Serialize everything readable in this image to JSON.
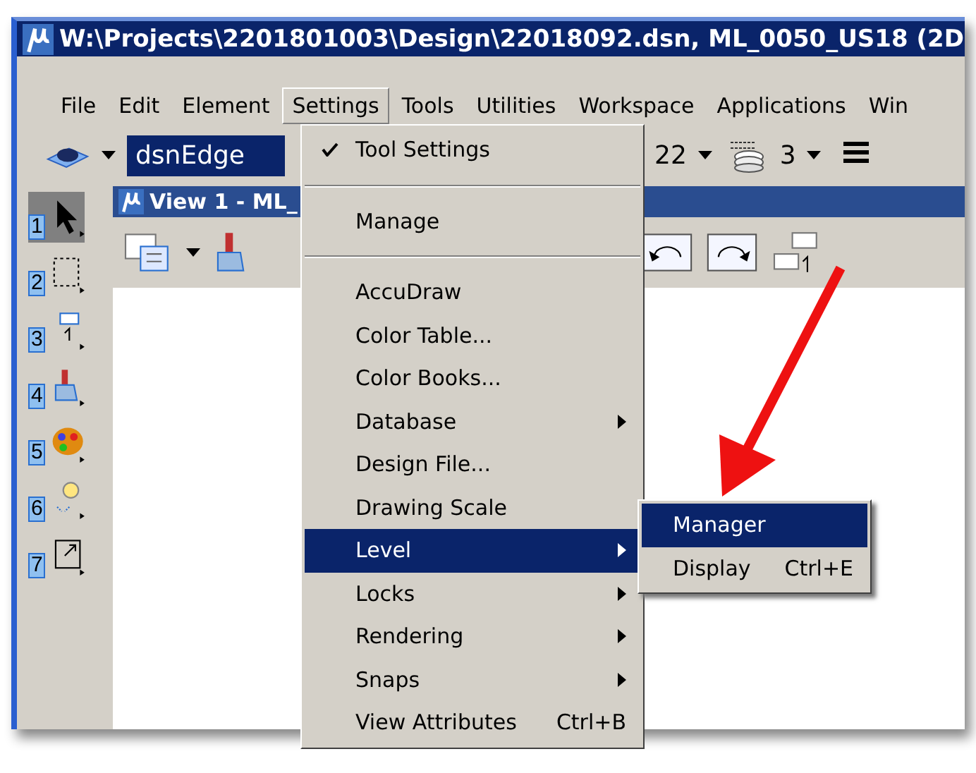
{
  "window": {
    "title": "W:\\Projects\\2201801003\\Design\\22018092.dsn, ML_0050_US18 (2D"
  },
  "menu_bar": [
    {
      "label": "File",
      "selected": false
    },
    {
      "label": "Edit",
      "selected": false
    },
    {
      "label": "Element",
      "selected": false
    },
    {
      "label": "Settings",
      "selected": true
    },
    {
      "label": "Tools",
      "selected": false
    },
    {
      "label": "Utilities",
      "selected": false
    },
    {
      "label": "Workspace",
      "selected": false
    },
    {
      "label": "Applications",
      "selected": false
    },
    {
      "label": "Win",
      "selected": false
    }
  ],
  "toolbar": {
    "combo_value": "dsnEdge",
    "field_2": "22",
    "layer_count": "3"
  },
  "tool_strip": [
    {
      "number": "1",
      "selected": true
    },
    {
      "number": "2",
      "selected": false
    },
    {
      "number": "3",
      "selected": false
    },
    {
      "number": "4",
      "selected": false
    },
    {
      "number": "5",
      "selected": false
    },
    {
      "number": "6",
      "selected": false
    },
    {
      "number": "7",
      "selected": false
    }
  ],
  "view": {
    "title": "View 1 - ML_"
  },
  "settings_menu": [
    {
      "kind": "item",
      "label": "Tool Settings",
      "checked": true,
      "submenu": false,
      "selected": false
    },
    {
      "kind": "separator"
    },
    {
      "kind": "item",
      "label": "Manage",
      "checked": false,
      "submenu": false,
      "selected": false
    },
    {
      "kind": "separator"
    },
    {
      "kind": "item",
      "label": "AccuDraw",
      "checked": false,
      "submenu": false,
      "selected": false
    },
    {
      "kind": "item",
      "label": "Color Table...",
      "checked": false,
      "submenu": false,
      "selected": false
    },
    {
      "kind": "item",
      "label": "Color Books...",
      "checked": false,
      "submenu": false,
      "selected": false
    },
    {
      "kind": "item",
      "label": "Database",
      "checked": false,
      "submenu": true,
      "selected": false
    },
    {
      "kind": "item",
      "label": "Design File...",
      "checked": false,
      "submenu": false,
      "selected": false
    },
    {
      "kind": "item",
      "label": "Drawing Scale",
      "checked": false,
      "submenu": false,
      "selected": false
    },
    {
      "kind": "item",
      "label": "Level",
      "checked": false,
      "submenu": true,
      "selected": true
    },
    {
      "kind": "item",
      "label": "Locks",
      "checked": false,
      "submenu": true,
      "selected": false
    },
    {
      "kind": "item",
      "label": "Rendering",
      "checked": false,
      "submenu": true,
      "selected": false
    },
    {
      "kind": "item",
      "label": "Snaps",
      "checked": false,
      "submenu": true,
      "selected": false
    },
    {
      "kind": "item",
      "label": "View Attributes",
      "shortcut": "Ctrl+B",
      "checked": false,
      "submenu": false,
      "selected": false
    }
  ],
  "level_submenu": [
    {
      "label": "Manager",
      "selected": true
    },
    {
      "label": "Display",
      "shortcut": "Ctrl+E",
      "selected": false
    }
  ]
}
